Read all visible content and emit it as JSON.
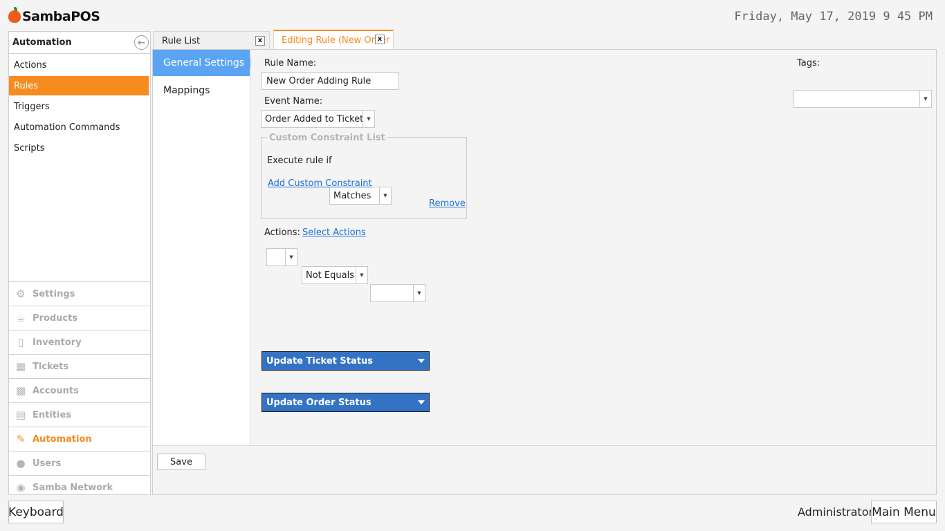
{
  "app": {
    "logo_text": "SambaPOS",
    "clock": "Friday, May 17, 2019 9 45 PM"
  },
  "left_panel": {
    "header": "Automation",
    "items": [
      {
        "label": "Actions",
        "active": false
      },
      {
        "label": "Rules",
        "active": true
      },
      {
        "label": "Triggers",
        "active": false
      },
      {
        "label": "Automation Commands",
        "active": false
      },
      {
        "label": "Scripts",
        "active": false
      }
    ],
    "nav": [
      {
        "label": "Settings",
        "icon": "gear-icon",
        "active": false
      },
      {
        "label": "Products",
        "icon": "coffee-cup-icon",
        "active": false
      },
      {
        "label": "Inventory",
        "icon": "box-icon",
        "active": false
      },
      {
        "label": "Tickets",
        "icon": "books-icon",
        "active": false
      },
      {
        "label": "Accounts",
        "icon": "calculator-icon",
        "active": false
      },
      {
        "label": "Entities",
        "icon": "grid-icon",
        "active": false
      },
      {
        "label": "Automation",
        "icon": "pencil-icon",
        "active": true
      },
      {
        "label": "Users",
        "icon": "user-icon",
        "active": false
      },
      {
        "label": "Samba Network",
        "icon": "globe-icon",
        "active": false
      }
    ]
  },
  "tabs": [
    {
      "label": "Rule List",
      "close": "x"
    },
    {
      "label": "Editing Rule (New Order Adding Rule)",
      "close": "x"
    }
  ],
  "subnav": [
    "General Settings",
    "Mappings"
  ],
  "form": {
    "rule_name_label": "Rule Name:",
    "rule_name_value": "New Order Adding Rule",
    "event_name_label": "Event Name:",
    "event_name_value": "Order Added to Ticket",
    "tags_label": "Tags:",
    "tags_value": "",
    "constraint_group_title": "Custom Constraint List",
    "execute_rule_label": "Execute rule if",
    "execute_rule_value": "Matches",
    "add_constraint_link": "Add Custom Constraint",
    "constraint_row": {
      "field": "",
      "operator": "Not Equals",
      "value": "",
      "remove": "Remove"
    },
    "actions_label": "Actions:",
    "select_actions_link": "Select Actions",
    "actions": [
      "Update Ticket Status",
      "Update Order Status"
    ]
  },
  "footer": {
    "save": "Save",
    "keyboard": "Keyboard",
    "user": "Administrator",
    "main_menu": "Main Menu"
  },
  "colors": {
    "accent": "#f68b1f",
    "selected_blue": "#5ba4f5",
    "action_blue": "#3472c4",
    "link": "#1a6ed8"
  }
}
